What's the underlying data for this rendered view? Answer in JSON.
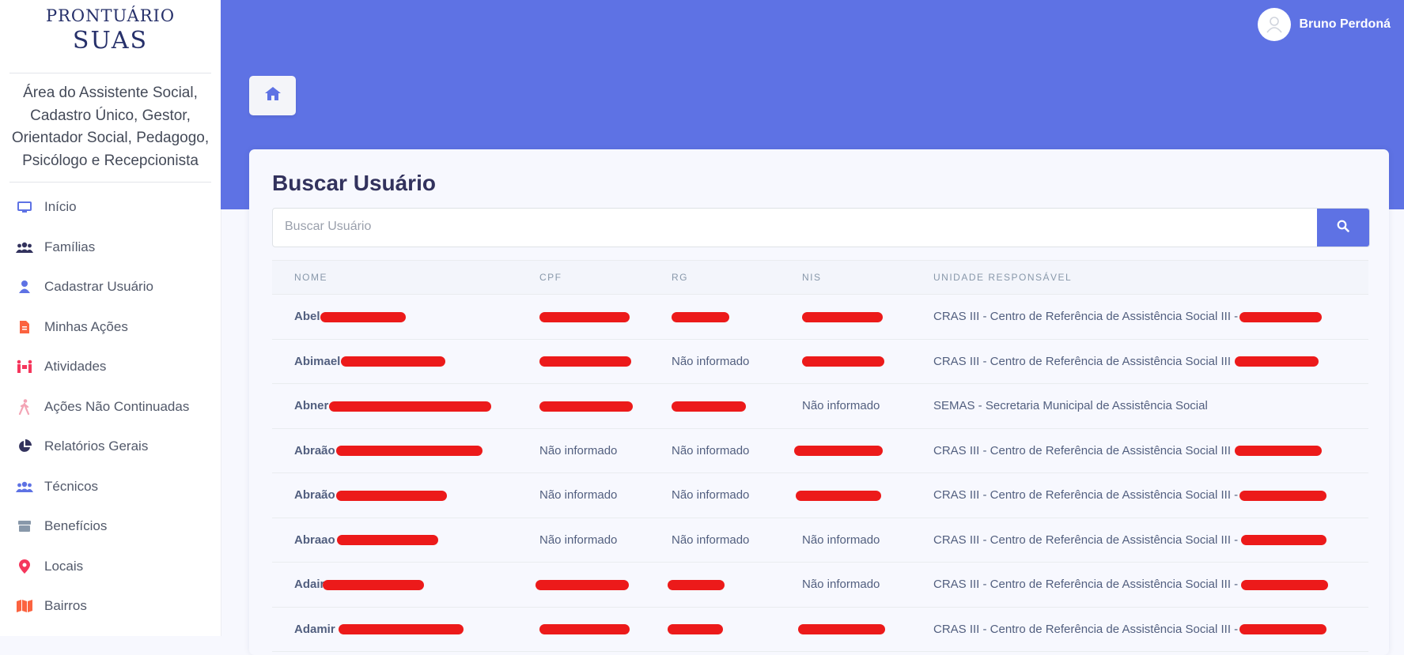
{
  "brand": {
    "line1": "PRONTUÁRIO",
    "line2": "SUAS"
  },
  "sidebar": {
    "role": "Área do Assistente Social, Cadastro Único, Gestor, Orientador Social, Pedagogo, Psicólogo e Recepcionista",
    "items": [
      {
        "label": "Início",
        "icon": "monitor-icon",
        "color": "#5e72e4"
      },
      {
        "label": "Famílias",
        "icon": "users-icon",
        "color": "#32325d"
      },
      {
        "label": "Cadastrar Usuário",
        "icon": "user-icon",
        "color": "#5e72e4"
      },
      {
        "label": "Minhas Ações",
        "icon": "file-icon",
        "color": "#fb6340"
      },
      {
        "label": "Atividades",
        "icon": "people-carry-icon",
        "color": "#f5365c"
      },
      {
        "label": "Ações Não Continuadas",
        "icon": "walking-icon",
        "color": "#f3a4b5"
      },
      {
        "label": "Relatórios Gerais",
        "icon": "pie-chart-icon",
        "color": "#32325d"
      },
      {
        "label": "Técnicos",
        "icon": "users-icon",
        "color": "#5e72e4"
      },
      {
        "label": "Benefícios",
        "icon": "box-icon",
        "color": "#8898aa"
      },
      {
        "label": "Locais",
        "icon": "map-marker-icon",
        "color": "#f5365c"
      },
      {
        "label": "Bairros",
        "icon": "map-icon",
        "color": "#fb6340"
      }
    ]
  },
  "header": {
    "user_name": "Bruno Perdoná",
    "avatar_icon": "user-circle-icon",
    "home_icon": "home-icon"
  },
  "main": {
    "title": "Buscar Usuário",
    "search_placeholder": "Buscar Usuário",
    "search_icon": "search-icon",
    "columns": [
      "NOME",
      "CPF",
      "RG",
      "NIS",
      "UNIDADE RESPONSÁVEL"
    ],
    "rows": [
      {
        "name": "Abel",
        "cpf": "",
        "rg": "",
        "nis": "",
        "unit": "CRAS III - Centro de Referência de Assistência Social III -"
      },
      {
        "name": "Abimael",
        "cpf": "",
        "rg": "Não informado",
        "nis": "",
        "unit": "CRAS III - Centro de Referência de Assistência Social III"
      },
      {
        "name": "Abner",
        "cpf": "",
        "rg": "",
        "nis": "Não informado",
        "unit": "SEMAS - Secretaria Municipal de Assistência Social"
      },
      {
        "name": "Abraão",
        "cpf": "Não informado",
        "rg": "Não informado",
        "nis": "",
        "unit": "CRAS III - Centro de Referência de Assistência Social III"
      },
      {
        "name": "Abraão",
        "cpf": "Não informado",
        "rg": "Não informado",
        "nis": "",
        "unit": "CRAS III - Centro de Referência de Assistência Social III -"
      },
      {
        "name": "Abraao",
        "cpf": "Não informado",
        "rg": "Não informado",
        "nis": "Não informado",
        "unit": "CRAS III - Centro de Referência de Assistência Social III -"
      },
      {
        "name": "Adair",
        "cpf": "",
        "rg": "",
        "nis": "Não informado",
        "unit": "CRAS III - Centro de Referência de Assistência Social III -"
      },
      {
        "name": "Adamir",
        "cpf": "",
        "rg": "",
        "nis": "",
        "unit": "CRAS III - Centro de Referência de Assistência Social III -"
      }
    ]
  },
  "colors": {
    "primary": "#5e72e4",
    "redaction": "#ec1a1a",
    "heading": "#32325d"
  }
}
